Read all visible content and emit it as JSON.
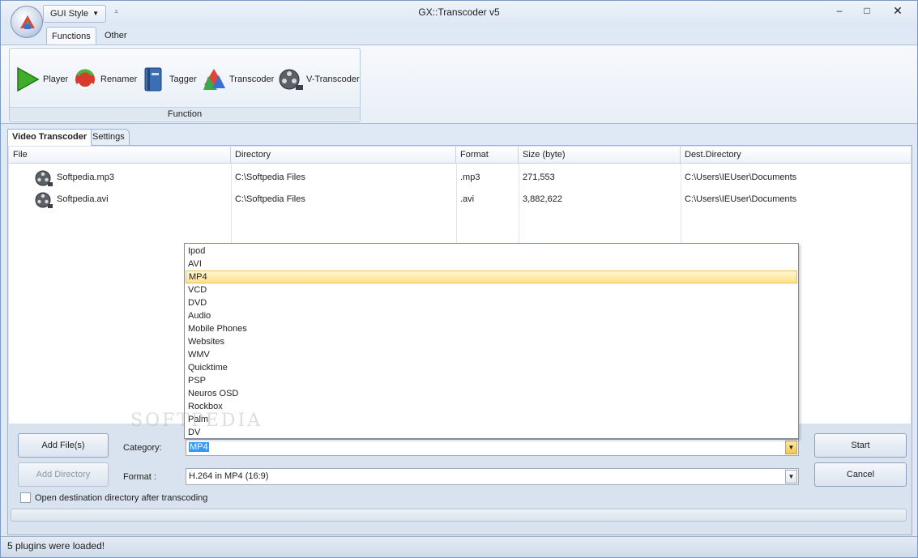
{
  "window": {
    "title": "GX::Transcoder v5",
    "gui_style_label": "GUI Style",
    "minimize": "–",
    "maximize": "□",
    "close": "✕"
  },
  "ribbon": {
    "tabs": [
      {
        "label": "Functions",
        "active": true
      },
      {
        "label": "Other",
        "active": false
      }
    ],
    "group_label": "Function",
    "buttons": [
      {
        "label": "Player",
        "icon": "play-icon"
      },
      {
        "label": "Renamer",
        "icon": "renamer-icon"
      },
      {
        "label": "Tagger",
        "icon": "tagger-icon"
      },
      {
        "label": "Transcoder",
        "icon": "transcoder-icon"
      },
      {
        "label": "V-Transcoder",
        "icon": "film-reel-icon"
      }
    ]
  },
  "doc_tabs": [
    {
      "label": "Video Transcoder",
      "active": true
    },
    {
      "label": "Settings",
      "active": false
    }
  ],
  "table": {
    "columns": [
      "File",
      "Directory",
      "Format",
      "Size (byte)",
      "Dest.Directory"
    ],
    "rows": [
      {
        "file": "Softpedia.mp3",
        "directory": "C:\\Softpedia Files",
        "format": ".mp3",
        "size": "271,553",
        "dest": "C:\\Users\\IEUser\\Documents"
      },
      {
        "file": "Softpedia.avi",
        "directory": "C:\\Softpedia Files",
        "format": ".avi",
        "size": "3,882,622",
        "dest": "C:\\Users\\IEUser\\Documents"
      }
    ]
  },
  "dropdown": {
    "items": [
      "Ipod",
      "AVI",
      "MP4",
      "VCD",
      "DVD",
      "Audio",
      "Mobile Phones",
      "Websites",
      "WMV",
      "Quicktime",
      "PSP",
      "Neuros OSD",
      "Rockbox",
      "Palm",
      "DV"
    ],
    "highlighted": "MP4"
  },
  "controls": {
    "add_files": "Add File(s)",
    "add_directory": "Add Directory",
    "start": "Start",
    "cancel": "Cancel",
    "category_label": "Category:",
    "category_value": "MP4",
    "format_label": "Format :",
    "format_value": "H.264 in MP4 (16:9)",
    "open_dest_label": "Open destination directory after transcoding",
    "open_dest_checked": false
  },
  "watermark": "SOFTPEDIA",
  "status": "5 plugins were loaded!"
}
